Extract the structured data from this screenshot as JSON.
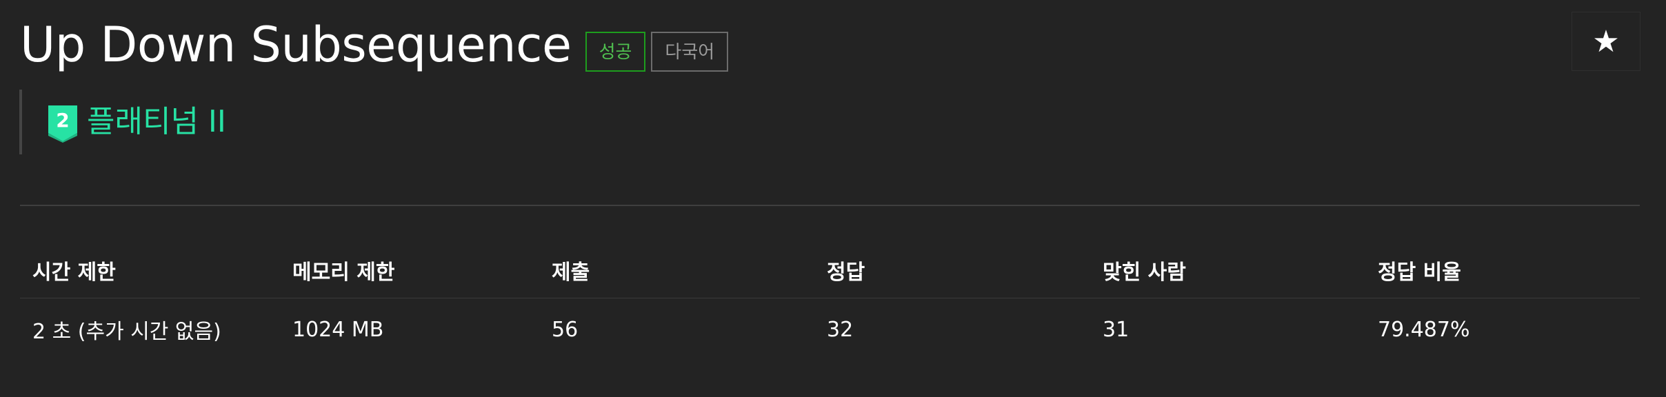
{
  "problem": {
    "title": "Up Down Subsequence",
    "badges": {
      "success": "성공",
      "multilang": "다국어"
    },
    "star_icon": "star-icon",
    "star_glyph": "★"
  },
  "tier": {
    "number": "2",
    "label": "플래티넘 II",
    "color": "#27e2a4",
    "icon": "platinum-tier-icon"
  },
  "info_table": {
    "headers": [
      "시간 제한",
      "메모리 제한",
      "제출",
      "정답",
      "맞힌 사람",
      "정답 비율"
    ],
    "rows": [
      [
        "2 초 (추가 시간 없음)",
        "1024 MB",
        "56",
        "32",
        "31",
        "79.487%"
      ]
    ]
  },
  "colors": {
    "background": "#232323",
    "success_border": "#1d9e1d",
    "success_text": "#4fbf4f",
    "multilang_border": "#6c6c6c"
  }
}
